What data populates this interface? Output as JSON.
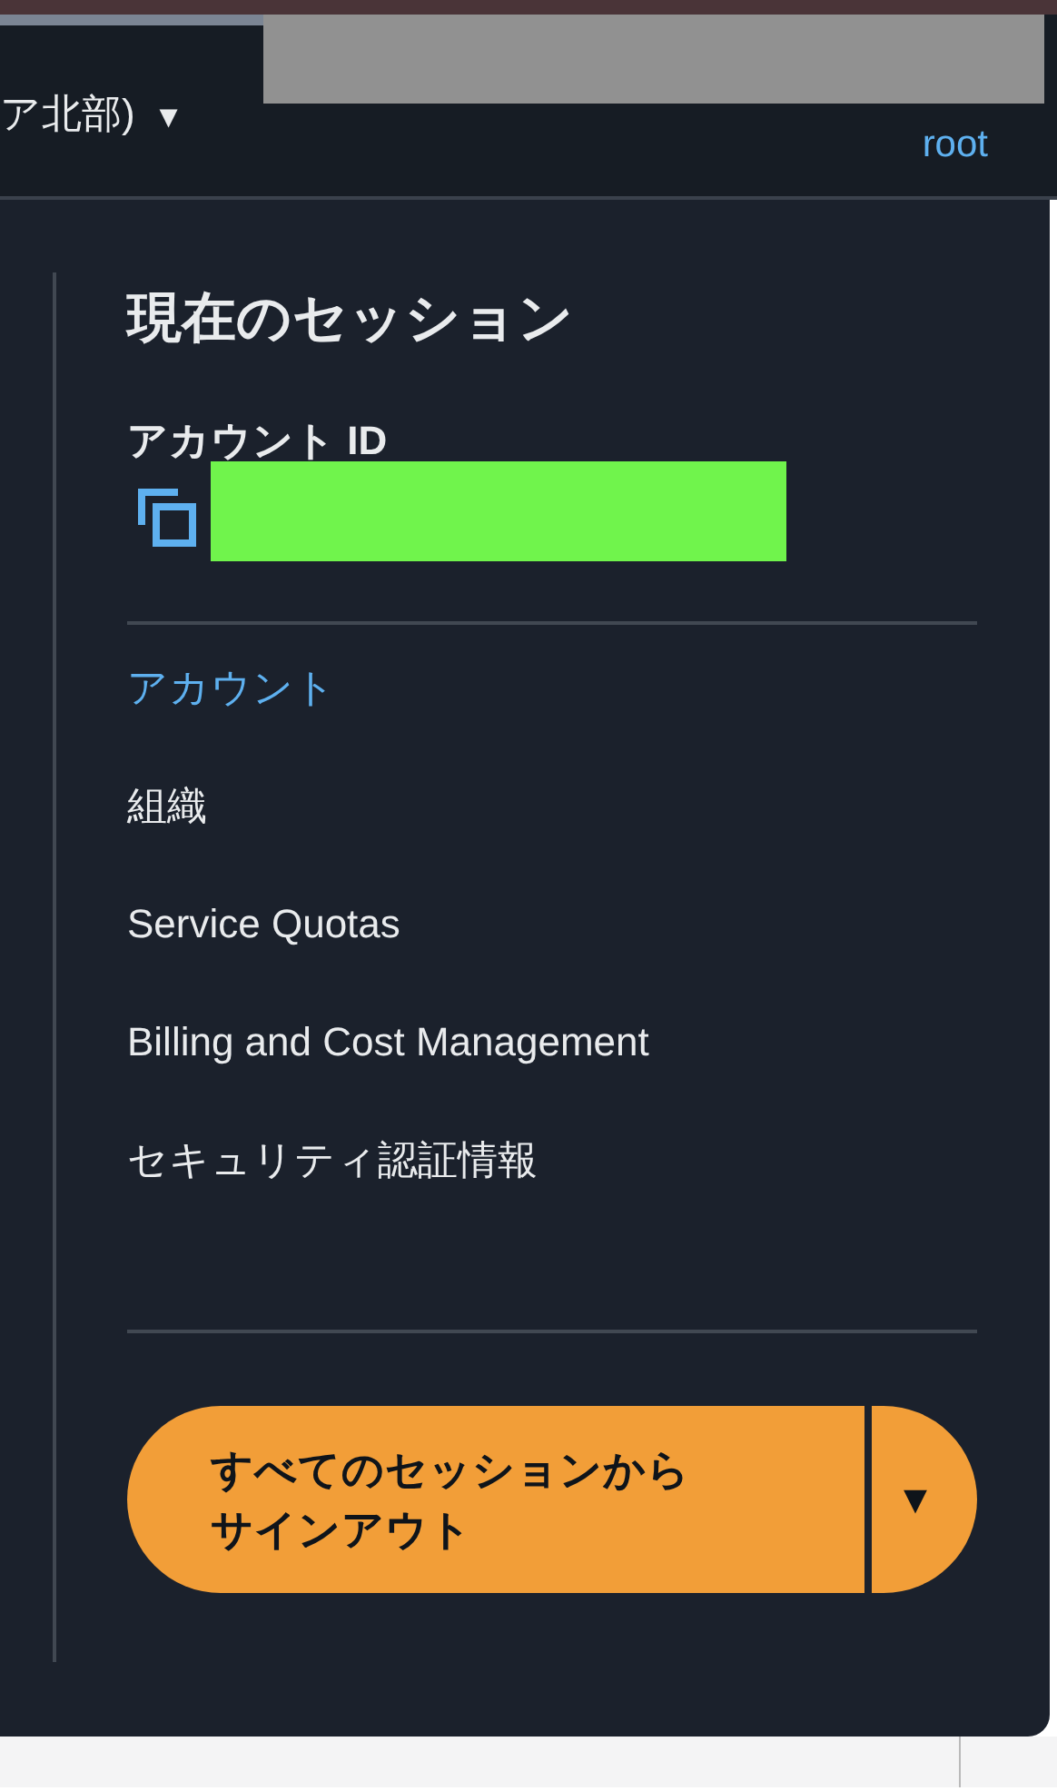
{
  "header": {
    "region": "ア北部)",
    "region_caret": "▼",
    "user": "root"
  },
  "session": {
    "title": "現在のセッション",
    "account_id_label": "アカウント ID"
  },
  "menu": [
    {
      "label": "アカウント",
      "selected": true
    },
    {
      "label": "組織",
      "selected": false
    },
    {
      "label": "Service Quotas",
      "selected": false
    },
    {
      "label": "Billing and Cost Management",
      "selected": false
    },
    {
      "label": "セキュリティ認証情報",
      "selected": false
    }
  ],
  "signout_button": {
    "label": "すべてのセッションからサインアウト",
    "caret": "▼"
  }
}
